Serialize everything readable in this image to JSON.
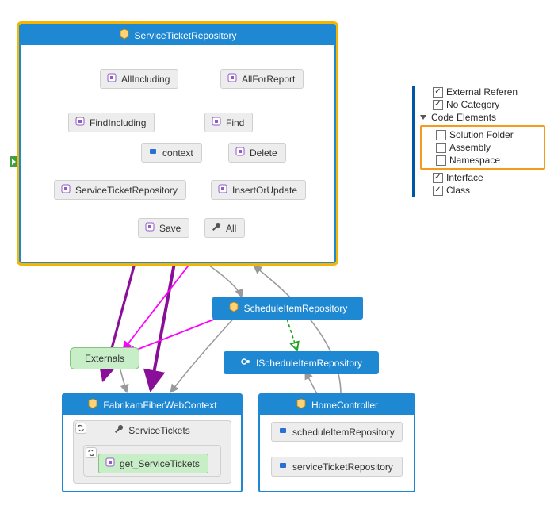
{
  "diagram": {
    "serviceTicketRepo": {
      "title": "ServiceTicketRepository",
      "nodes": {
        "allIncluding": "AllIncluding",
        "allForReport": "AllForReport",
        "findIncluding": "FindIncluding",
        "find": "Find",
        "context": "context",
        "delete": "Delete",
        "repo": "ServiceTicketRepository",
        "insertOrUpdate": "InsertOrUpdate",
        "save": "Save",
        "all": "All"
      }
    },
    "scheduleItemRepo": {
      "title": "ScheduleItemRepository"
    },
    "iScheduleItemRepo": {
      "title": "IScheduleItemRepository"
    },
    "externals": {
      "title": "Externals"
    },
    "fabrikam": {
      "title": "FabrikamFiberWebContext",
      "serviceTickets": "ServiceTickets",
      "getServiceTickets": "get_ServiceTickets"
    },
    "home": {
      "title": "HomeController",
      "scheduleItemRepository": "scheduleItemRepository",
      "serviceTicketRepository": "serviceTicketRepository"
    }
  },
  "legend": {
    "externalReferen": "External Referen",
    "noCategory": "No Category",
    "codeElements": "Code Elements",
    "solutionFolder": "Solution Folder",
    "assembly": "Assembly",
    "namespace": "Namespace",
    "interface": "Interface",
    "class": "Class"
  },
  "icons": {
    "class": "class",
    "method": "method",
    "field": "field",
    "wrench": "wrench",
    "interface": "interface"
  }
}
